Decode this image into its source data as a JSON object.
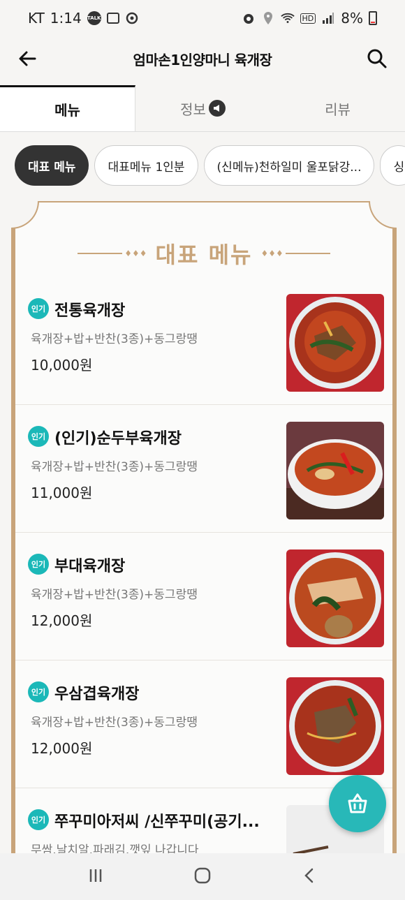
{
  "status": {
    "carrier": "KT",
    "time": "1:14",
    "battery": "8%",
    "talk_icon_text": "TALK",
    "hd_label": "HD"
  },
  "header": {
    "title": "엄마손1인양마니 육개장"
  },
  "tabs": [
    {
      "label": "메뉴"
    },
    {
      "label": "정보"
    },
    {
      "label": "리뷰"
    }
  ],
  "chips": [
    {
      "label": "대표 메뉴"
    },
    {
      "label": "대표메뉴 1인분"
    },
    {
      "label": "(신메뉴)천하일미 울포닭강..."
    },
    {
      "label": "싱"
    }
  ],
  "section": {
    "title": "대표 메뉴",
    "deco": "♦♦♦"
  },
  "menu_items": [
    {
      "badge": "인기",
      "name": "전통육개장",
      "desc": "육개장+밥+반찬(3종)+동그랑땡",
      "price": "10,000원"
    },
    {
      "badge": "인기",
      "name": "(인기)순두부육개장",
      "desc": "육개장+밥+반찬(3종)+동그랑땡",
      "price": "11,000원"
    },
    {
      "badge": "인기",
      "name": "부대육개장",
      "desc": "육개장+밥+반찬(3종)+동그랑땡",
      "price": "12,000원"
    },
    {
      "badge": "인기",
      "name": "우삼겹육개장",
      "desc": "육개장+밥+반찬(3종)+동그랑땡",
      "price": "12,000원"
    },
    {
      "badge": "인기",
      "name": "쭈꾸미아저씨  /신쭈꾸미(공기...",
      "desc": "무쌈.날치알.파래김.깻잎 나갑니다",
      "price": ""
    }
  ],
  "colors": {
    "accent_gold": "#c8a47a",
    "badge_teal": "#1bb8b8",
    "fab_teal": "#28b8b8"
  }
}
